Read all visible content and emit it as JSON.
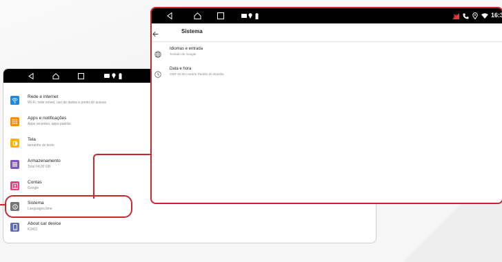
{
  "colors": {
    "accent_red": "#c8272b",
    "icon_blue": "#1e88e5",
    "icon_orange": "#fb8c00",
    "icon_amber": "#ffb300",
    "icon_purple": "#7e57c2",
    "icon_pink": "#ec407a",
    "icon_gray": "#757575",
    "icon_indigo": "#5c6bc0"
  },
  "back_device": {
    "settings_items": [
      {
        "title": "Rede e internet",
        "subtitle": "Wi-Fi, rede móvel, uso de dados e ponto de acesso",
        "icon": "wifi-icon",
        "color": "#1e88e5"
      },
      {
        "title": "Apps e notificações",
        "subtitle": "Apps recentes, apps padrão",
        "icon": "apps-grid-icon",
        "color": "#fb8c00"
      },
      {
        "title": "Tela",
        "subtitle": "tamanho do texto",
        "icon": "brightness-icon",
        "color": "#ffb300"
      },
      {
        "title": "Armazenamento",
        "subtitle": "Total 64,00 GB",
        "icon": "storage-icon",
        "color": "#7e57c2"
      },
      {
        "title": "Contas",
        "subtitle": "Google",
        "icon": "account-icon",
        "color": "#ec407a"
      },
      {
        "title": "Sistema",
        "subtitle": "Languages,time",
        "icon": "info-icon",
        "color": "#757575"
      },
      {
        "title": "About car device",
        "subtitle": "K2401",
        "icon": "phone-icon",
        "color": "#5c6bc0"
      }
    ]
  },
  "front_device": {
    "status_time": "16:3",
    "page_title": "Sistema",
    "items": [
      {
        "title": "Idiomas e entrada",
        "subtitle": "Teclado do Google",
        "icon": "globe-icon"
      },
      {
        "title": "Data e hora",
        "subtitle": "GMT-03:00 Horário Padrão de Brasília",
        "icon": "clock-icon"
      }
    ]
  }
}
